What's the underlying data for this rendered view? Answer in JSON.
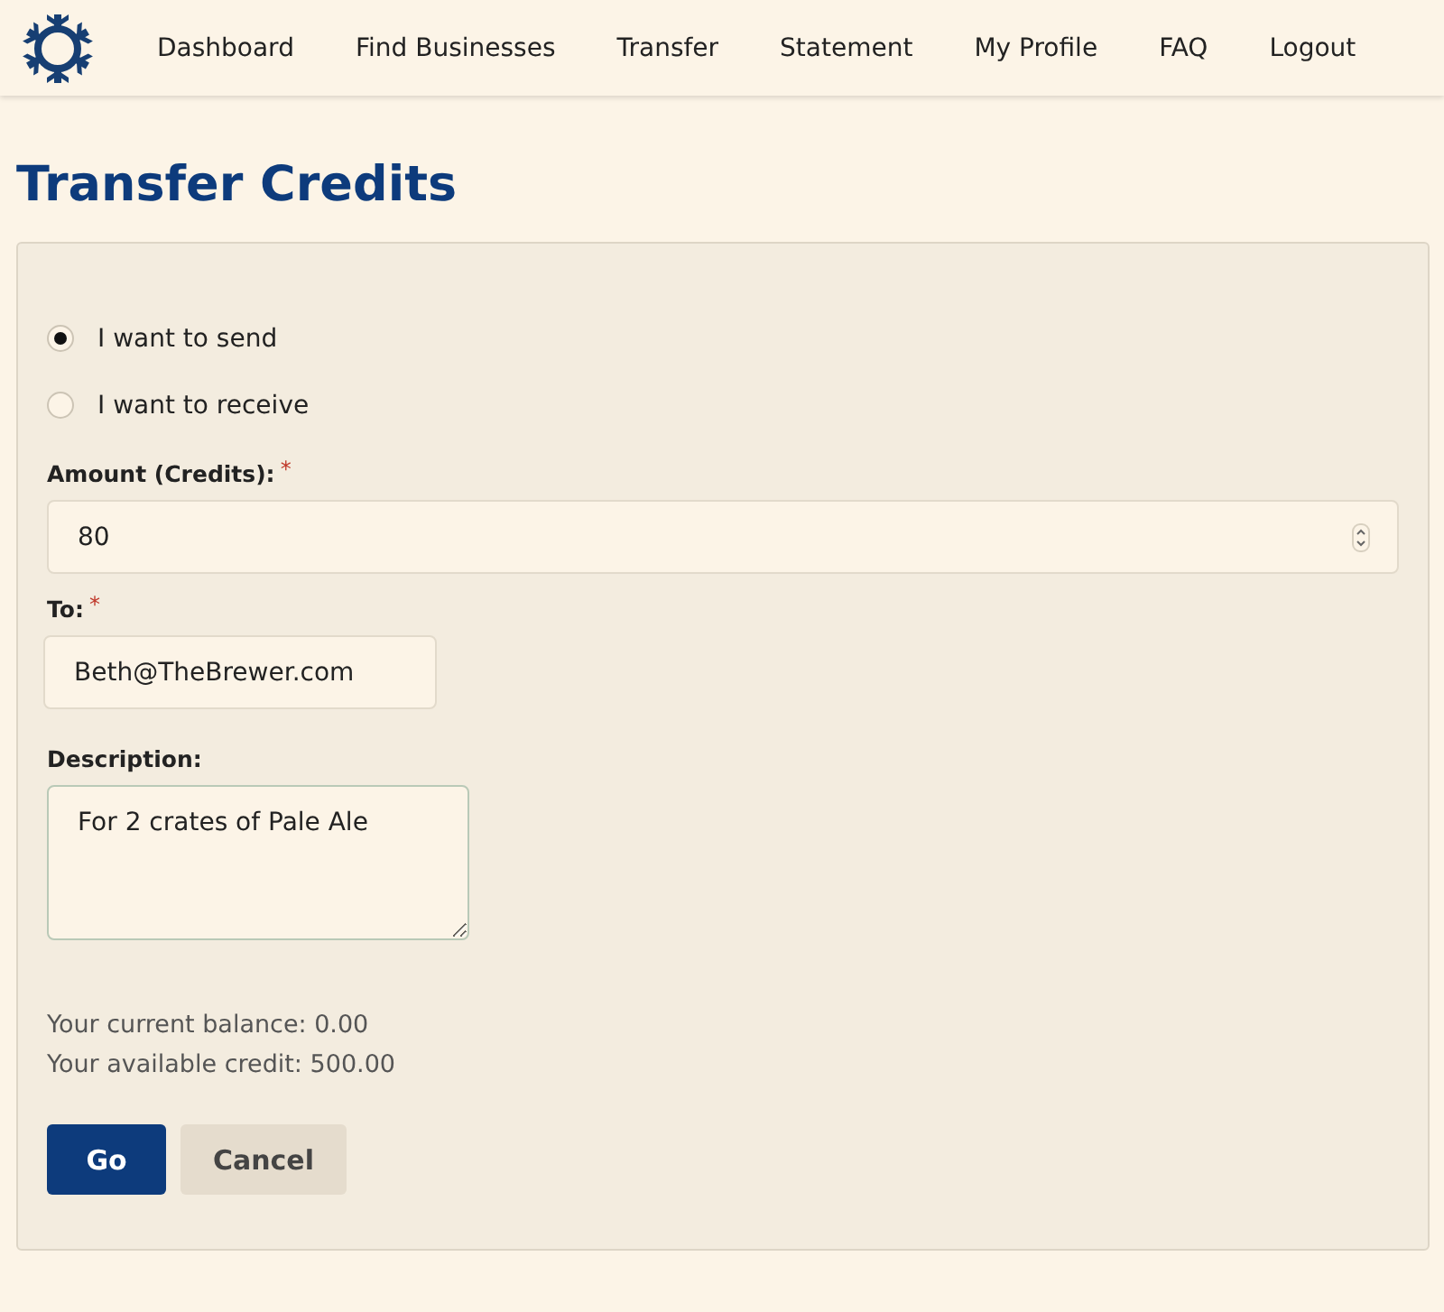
{
  "nav": {
    "items": [
      "Dashboard",
      "Find Businesses",
      "Transfer",
      "Statement",
      "My Profile",
      "FAQ",
      "Logout"
    ]
  },
  "page_title": "Transfer Credits",
  "direction_options": [
    {
      "label": "I want to send",
      "selected": true
    },
    {
      "label": "I want to receive",
      "selected": false
    }
  ],
  "fields": [
    {
      "kind": "number",
      "label": "Amount (Credits):",
      "required_mark": "*",
      "value": "80"
    },
    {
      "kind": "text",
      "label": "To:",
      "required_mark": "*",
      "value": "Beth@TheBrewer.com"
    },
    {
      "kind": "textarea",
      "label": "Description:",
      "value": "For 2 crates of Pale Ale"
    }
  ],
  "balance_lines": [
    "Your current balance: 0.00",
    "Your available credit: 500.00"
  ],
  "buttons": [
    {
      "kind": "primary",
      "label": "Go"
    },
    {
      "kind": "secondary",
      "label": "Cancel"
    }
  ]
}
